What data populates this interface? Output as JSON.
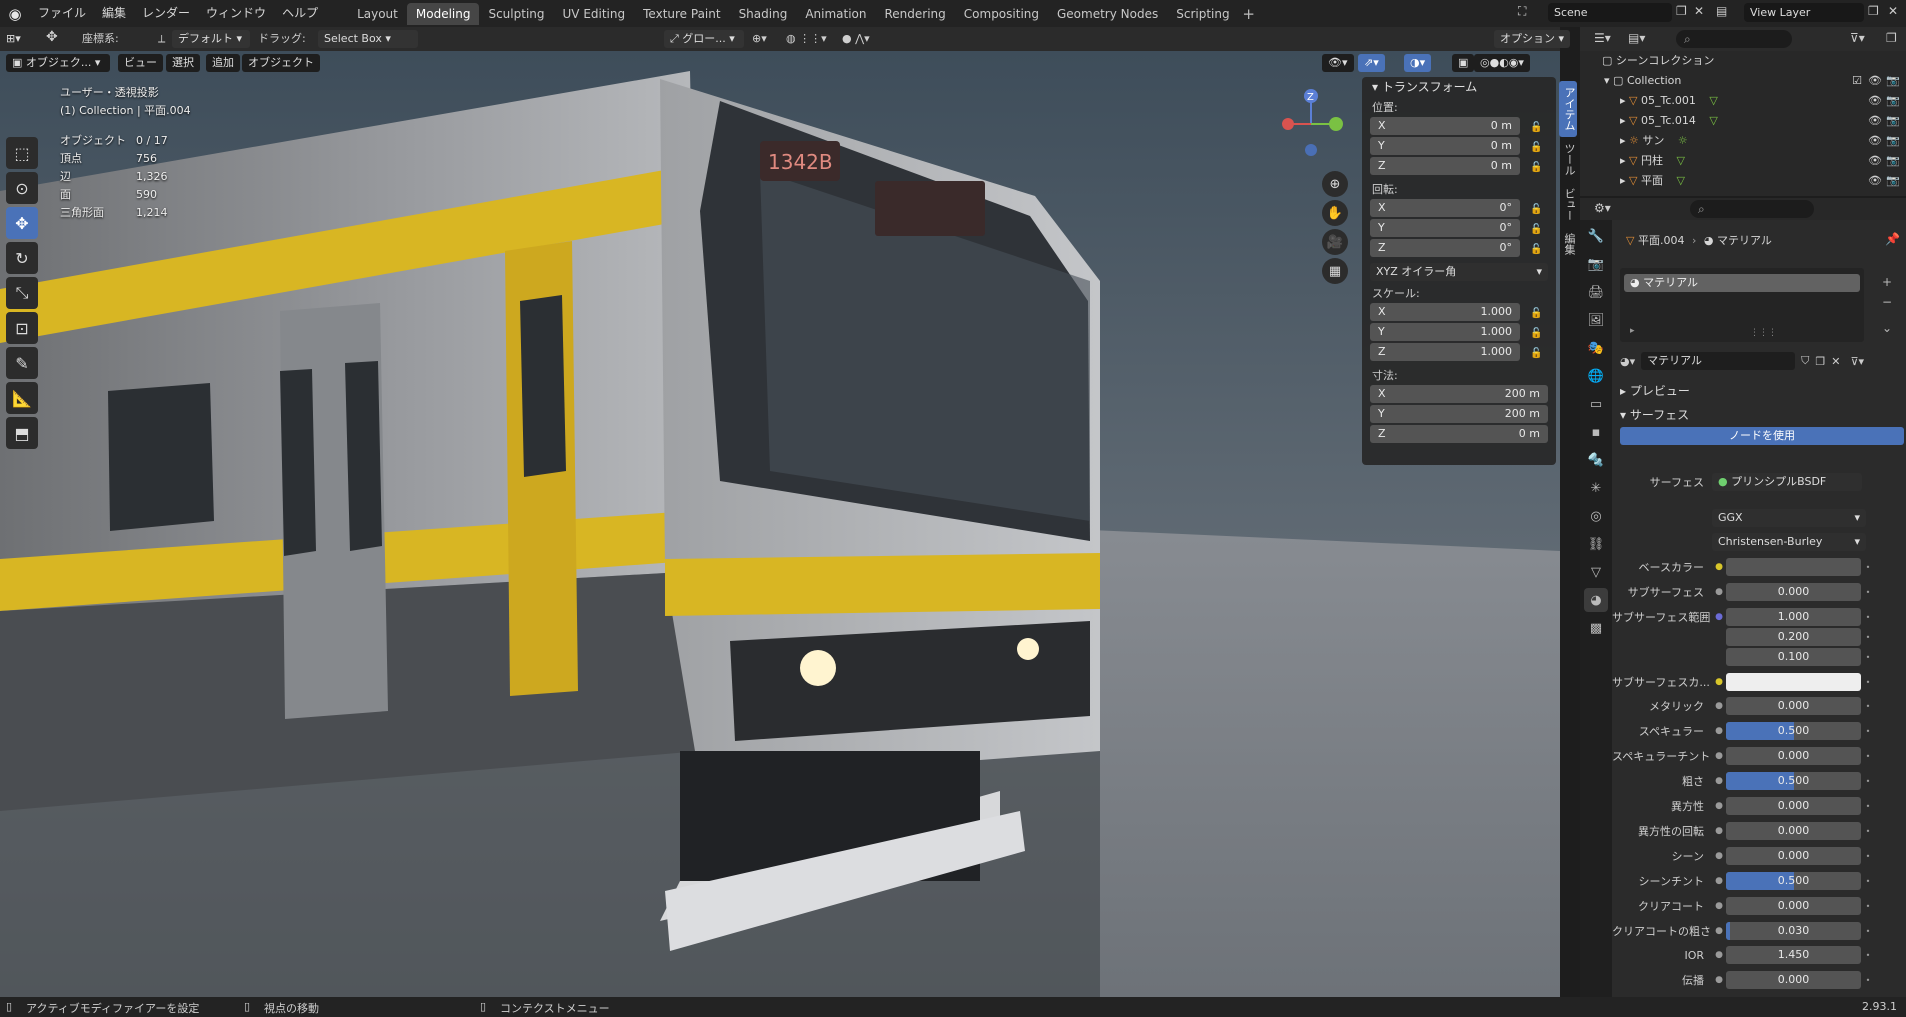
{
  "menu": {
    "items": [
      "ファイル",
      "編集",
      "レンダー",
      "ウィンドウ",
      "ヘルプ"
    ]
  },
  "workspaces": {
    "tabs": [
      "Layout",
      "Modeling",
      "Sculpting",
      "UV Editing",
      "Texture Paint",
      "Shading",
      "Animation",
      "Rendering",
      "Compositing",
      "Geometry Nodes",
      "Scripting"
    ],
    "active": "Modeling"
  },
  "scene": {
    "name": "Scene",
    "view_layer": "View Layer"
  },
  "viewport_header": {
    "coord_label": "座標系:",
    "coord_value": "デフォルト",
    "drag_label": "ドラッグ:",
    "drag_value": "Select Box",
    "transform_value": "グロー...",
    "options_label": "オプション",
    "mode": "オブジェク...",
    "view": "ビュー",
    "select": "選択",
    "add": "追加",
    "object": "オブジェクト"
  },
  "viewport_info": {
    "projection": "ユーザー・透視投影",
    "collection": "(1) Collection | 平面.004",
    "stats": [
      {
        "label": "オブジェクト",
        "value": "0 / 17"
      },
      {
        "label": "頂点",
        "value": "756"
      },
      {
        "label": "辺",
        "value": "1,326"
      },
      {
        "label": "面",
        "value": "590"
      },
      {
        "label": "三角形面",
        "value": "1,214"
      }
    ]
  },
  "gizmo": {
    "z_label": "Z"
  },
  "n_panel": {
    "title": "トランスフォーム",
    "location_label": "位置:",
    "location": [
      {
        "axis": "X",
        "value": "0 m"
      },
      {
        "axis": "Y",
        "value": "0 m"
      },
      {
        "axis": "Z",
        "value": "0 m"
      }
    ],
    "rotation_label": "回転:",
    "rotation": [
      {
        "axis": "X",
        "value": "0°"
      },
      {
        "axis": "Y",
        "value": "0°"
      },
      {
        "axis": "Z",
        "value": "0°"
      }
    ],
    "rotation_mode": "XYZ オイラー角",
    "scale_label": "スケール:",
    "scale": [
      {
        "axis": "X",
        "value": "1.000"
      },
      {
        "axis": "Y",
        "value": "1.000"
      },
      {
        "axis": "Z",
        "value": "1.000"
      }
    ],
    "dimensions_label": "寸法:",
    "dimensions": [
      {
        "axis": "X",
        "value": "200 m"
      },
      {
        "axis": "Y",
        "value": "200 m"
      },
      {
        "axis": "Z",
        "value": "0 m"
      }
    ],
    "side_tabs": [
      "アイテム",
      "ツール",
      "ビュー",
      "編集"
    ]
  },
  "outliner": {
    "root": "シーンコレクション",
    "collection": "Collection",
    "items": [
      "05_Tc.001",
      "05_Tc.014",
      "サン",
      "円柱",
      "平面"
    ]
  },
  "properties": {
    "object_name": "平面.004",
    "context": "マテリアル",
    "slot": "マテリアル",
    "material_name": "マテリアル",
    "preview_label": "プレビュー",
    "surface_label": "サーフェス",
    "use_nodes": "ノードを使用",
    "surface_field_label": "サーフェス",
    "surface_shader": "プリンシプルBSDF",
    "distribution": "GGX",
    "subsurface_method": "Christensen-Burley",
    "fields": [
      {
        "label": "ベースカラー",
        "value": "",
        "type": "color",
        "color": "#555555"
      },
      {
        "label": "サブサーフェス",
        "value": "0.000",
        "fill": 0
      },
      {
        "label": "サブサーフェス範囲",
        "value": "1.000",
        "fill": 0
      },
      {
        "label": "",
        "value": "0.200",
        "fill": 0
      },
      {
        "label": "",
        "value": "0.100",
        "fill": 0
      },
      {
        "label": "サブサーフェスカ...",
        "value": "",
        "type": "color",
        "color": "#eeeeee"
      },
      {
        "label": "メタリック",
        "value": "0.000",
        "fill": 0
      },
      {
        "label": "スペキュラー",
        "value": "0.500",
        "fill": 0.5
      },
      {
        "label": "スペキュラーチント",
        "value": "0.000",
        "fill": 0
      },
      {
        "label": "粗さ",
        "value": "0.500",
        "fill": 0.5
      },
      {
        "label": "異方性",
        "value": "0.000",
        "fill": 0
      },
      {
        "label": "異方性の回転",
        "value": "0.000",
        "fill": 0
      },
      {
        "label": "シーン",
        "value": "0.000",
        "fill": 0
      },
      {
        "label": "シーンチント",
        "value": "0.500",
        "fill": 0.5
      },
      {
        "label": "クリアコート",
        "value": "0.000",
        "fill": 0
      },
      {
        "label": "クリアコートの粗さ",
        "value": "0.030",
        "fill": 0.03
      },
      {
        "label": "IOR",
        "value": "1.450",
        "fill": 0
      },
      {
        "label": "伝播",
        "value": "0.000",
        "fill": 0
      }
    ]
  },
  "status_bar": {
    "left": "アクティブモディファイアーを設定",
    "middle": "視点の移動",
    "right": "コンテクストメニュー",
    "version": "2.93.1"
  },
  "colors": {
    "accent": "#4a72b8",
    "yellow_stripe": "#d8b623"
  }
}
